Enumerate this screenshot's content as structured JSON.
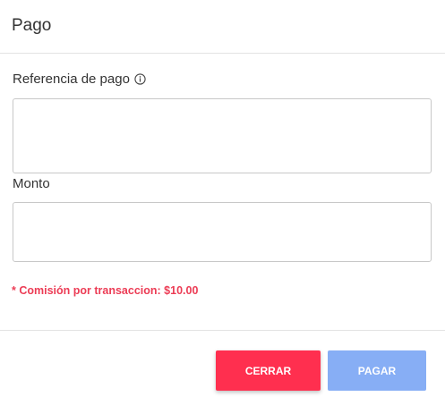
{
  "dialog": {
    "title": "Pago"
  },
  "form": {
    "reference_label": "Referencia de pago",
    "reference_value": "",
    "amount_label": "Monto",
    "amount_value": "",
    "fee_note": "* Comisión por transaccion: $10.00"
  },
  "actions": {
    "close_label": "CERRAR",
    "pay_label": "PAGAR"
  },
  "colors": {
    "close_button": "#ff2f4f",
    "pay_button_disabled": "#87aef5",
    "fee_note": "#ec3c55"
  },
  "icons": {
    "reference_info": "info-circle-icon"
  }
}
